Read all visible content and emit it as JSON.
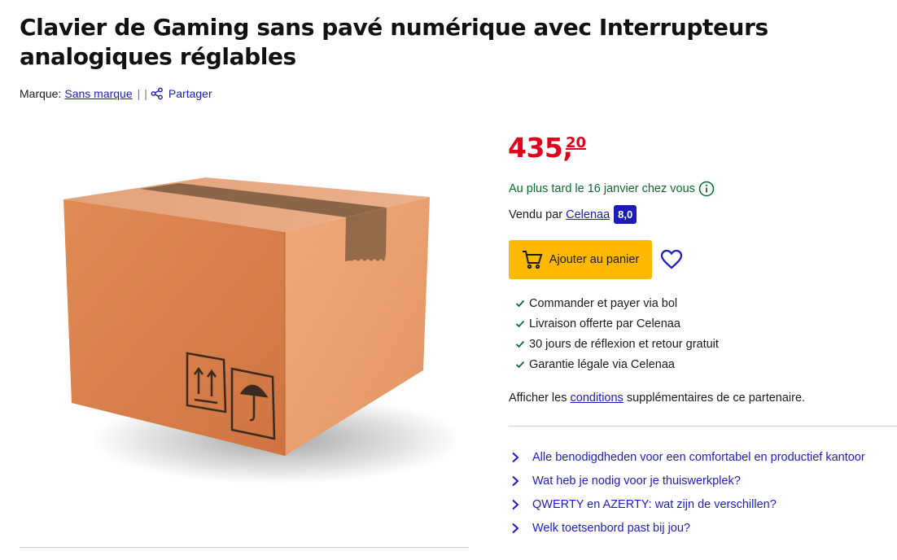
{
  "product": {
    "title": "Clavier de Gaming sans pavé numérique avec Interrupteurs analogiques réglables",
    "brand_label": "Marque:",
    "brand_name": "Sans marque",
    "separator": "|",
    "share_label": "Partager"
  },
  "price": {
    "euros": "435",
    "comma": ",",
    "cents": "20",
    "color": "#e3001b"
  },
  "delivery": {
    "text": "Au plus tard le 16 janvier chez vous",
    "icon": "info-icon"
  },
  "seller": {
    "label": "Vendu par",
    "name": "Celenaa",
    "rating": "8,0"
  },
  "cart": {
    "label": "Ajouter au panier",
    "icon": "cart-icon",
    "color": "#ffb800"
  },
  "wishlist": {
    "icon": "heart-icon"
  },
  "usps": [
    "Commander et payer via bol",
    "Livraison offerte par Celenaa",
    "30 jours de réflexion et retour gratuit",
    "Garantie légale via Celenaa"
  ],
  "conditions": {
    "before": "Afficher les ",
    "link": "conditions",
    "after": " supplémentaires de ce partenaire."
  },
  "related_links": [
    "Alle benodigdheden voor een comfortabel en productief kantoor",
    "Wat heb je nodig voor je thuiswerkplek?",
    "QWERTY en AZERTY: wat zijn de verschillen?",
    "Welk toetsenbord past bij jou?"
  ],
  "colors": {
    "link": "#1d1cbf",
    "delivery": "#0a6b2e",
    "rating_badge": "#1c1ab8"
  }
}
